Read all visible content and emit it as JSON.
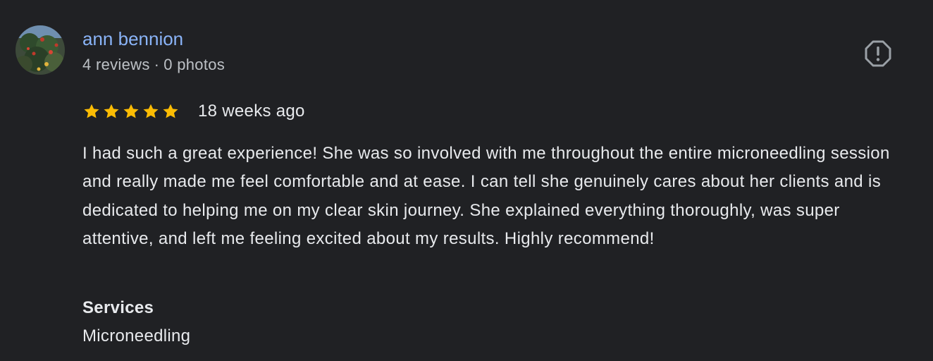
{
  "reviewer": {
    "name": "ann bennion",
    "reviews_count": "4 reviews",
    "separator": "·",
    "photos_count": "0 photos",
    "avatar_icon": "profile-photo"
  },
  "review": {
    "rating": 5,
    "rating_max": 5,
    "star_color": "#fbbc04",
    "time_ago": "18 weeks ago",
    "text": "I had such a great experience! She was so involved with me throughout the entire microneedling session and really made me feel comfortable and at ease. I can tell she genuinely cares about her clients and is dedicated to helping me on my clear skin journey. She explained everything thoroughly, was super attentive, and left me feeling excited about my results. Highly recommend!"
  },
  "services": {
    "label": "Services",
    "value": "Microneedling"
  },
  "actions": {
    "report_icon": "report-icon"
  },
  "colors": {
    "background": "#202124",
    "name_link": "#8ab4f8",
    "secondary_text": "#bdc1c6",
    "primary_text": "#e8eaed",
    "icon": "#9aa0a6"
  }
}
